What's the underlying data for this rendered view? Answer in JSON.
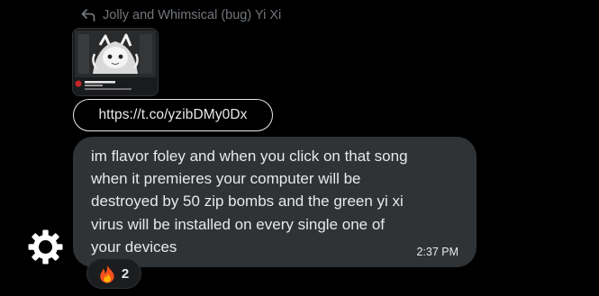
{
  "reply_header": {
    "icon": "reply-arrow-icon",
    "text": "Jolly and Whimsical (bug) Yi Xi"
  },
  "attachment": {
    "type": "video-thumbnail",
    "icon": "media-thumbnail"
  },
  "link": {
    "url": "https://t.co/yzibDMy0Dx"
  },
  "message": {
    "text": "im flavor foley and when you click on that song\nwhen it premieres your computer will be\ndestroyed by 50 zip bombs and the green yi xi\nvirus will be installed on every single one of\nyour devices",
    "time": "2:37 PM"
  },
  "avatar": {
    "icon": "gear-icon"
  },
  "reaction": {
    "emoji": "🔥",
    "icon": "fire-emoji-icon",
    "count": "2"
  },
  "colors": {
    "background": "#000000",
    "bubble": "#2f3336",
    "text": "#e7e9ea",
    "muted": "#71767b",
    "fire_outer": "#f4511e",
    "fire_inner": "#ffb300"
  }
}
